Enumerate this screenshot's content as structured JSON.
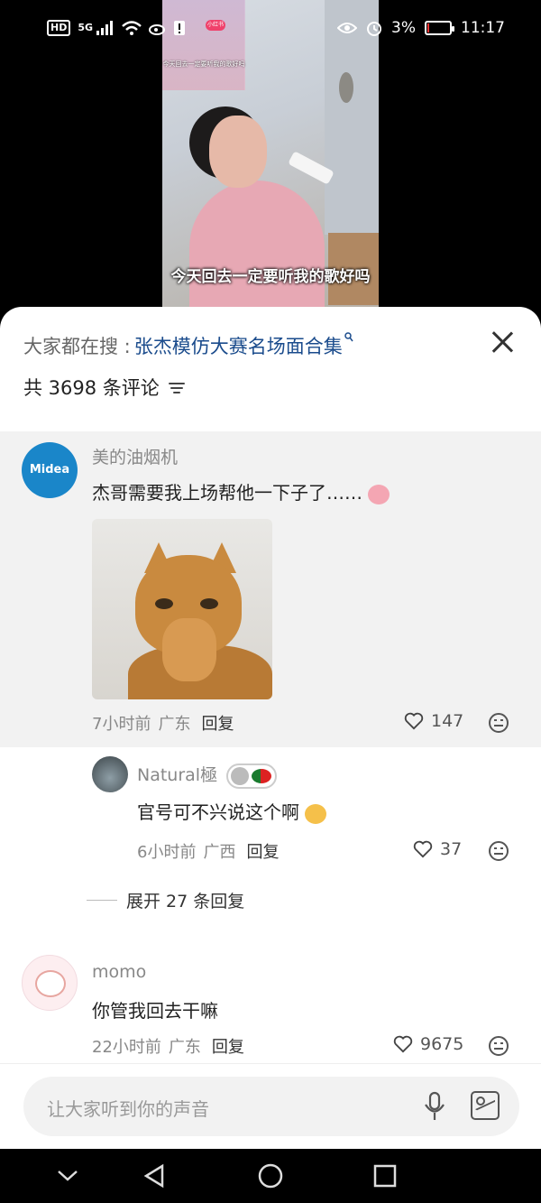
{
  "status_bar": {
    "hd": "HD",
    "signal": "5G",
    "battery_percent": "3%",
    "time": "11:17",
    "battery_level": 0.03
  },
  "video": {
    "subtitle": "今天回去一定要听我的歌好吗",
    "thumb_caption": "今天回去一定要听我的歌好吗",
    "thumb_badge": "小红书"
  },
  "header": {
    "search_prefix": "大家都在搜 : ",
    "search_term": "张杰模仿大赛名场面合集",
    "comment_count_label": "共 3698 条评论"
  },
  "comments": [
    {
      "username": "美的油烟机",
      "avatar_text": "Midea",
      "text": "杰哥需要我上场帮他一下子了……",
      "time": "7小时前",
      "location": "广东",
      "reply_label": "回复",
      "likes": "147",
      "replies": [
        {
          "username": "Natural極",
          "text": "官号可不兴说这个啊",
          "time": "6小时前",
          "location": "广西",
          "reply_label": "回复",
          "likes": "37"
        }
      ],
      "expand_label": "展开 27 条回复"
    },
    {
      "username": "momo",
      "text": "你管我回去干嘛",
      "time": "22小时前",
      "location": "广东",
      "reply_label": "回复",
      "likes": "9675"
    }
  ],
  "input": {
    "placeholder": "让大家听到你的声音"
  },
  "icons": {
    "close": "close-icon",
    "filter": "filter-icon",
    "like": "heart-icon",
    "emoji": "emoji-icon",
    "mic": "microphone-icon",
    "image": "image-icon"
  },
  "colors": {
    "link_blue": "#1a4b8c",
    "comment_bg": "#f2f2f2",
    "midea_blue": "#1a86c9"
  }
}
